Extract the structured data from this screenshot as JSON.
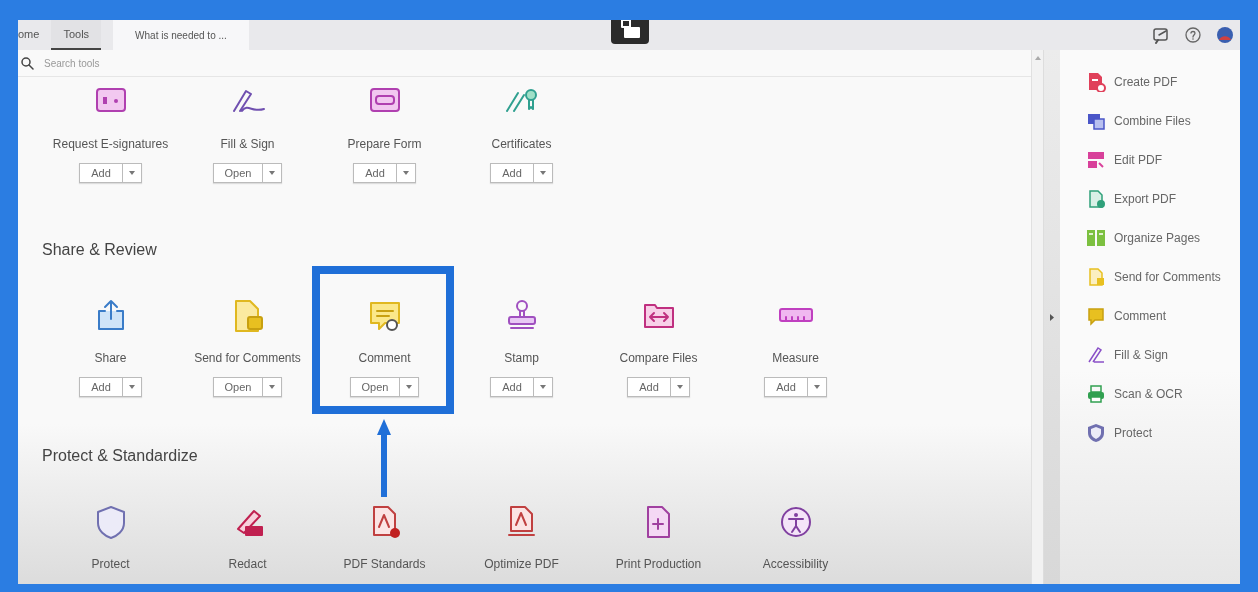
{
  "tabs": [
    {
      "label": "ome",
      "selected": false
    },
    {
      "label": "Tools",
      "selected": true
    }
  ],
  "document_tab": {
    "title": "What is needed to ..."
  },
  "search": {
    "placeholder": "Search tools"
  },
  "sections": [
    {
      "tools": [
        {
          "label": "Request E-signatures",
          "action": "Add",
          "highlighted": false
        },
        {
          "label": "Fill & Sign",
          "action": "Open",
          "highlighted": false
        },
        {
          "label": "Prepare Form",
          "action": "Add",
          "highlighted": false
        },
        {
          "label": "Certificates",
          "action": "Add",
          "highlighted": false
        }
      ]
    },
    {
      "heading": "Share & Review",
      "tools": [
        {
          "label": "Share",
          "action": "Add",
          "highlighted": false
        },
        {
          "label": "Send for Comments",
          "action": "Open",
          "highlighted": false
        },
        {
          "label": "Comment",
          "action": "Open",
          "highlighted": true
        },
        {
          "label": "Stamp",
          "action": "Add",
          "highlighted": false
        },
        {
          "label": "Compare Files",
          "action": "Add",
          "highlighted": false
        },
        {
          "label": "Measure",
          "action": "Add",
          "highlighted": false
        }
      ]
    },
    {
      "heading": "Protect & Standardize",
      "tools": [
        {
          "label": "Protect",
          "highlighted": false
        },
        {
          "label": "Redact",
          "highlighted": false
        },
        {
          "label": "PDF Standards",
          "highlighted": false
        },
        {
          "label": "Optimize PDF",
          "highlighted": false
        },
        {
          "label": "Print Production",
          "highlighted": false
        },
        {
          "label": "Accessibility",
          "highlighted": false
        }
      ]
    }
  ],
  "sidebar": {
    "items": [
      {
        "label": "Create PDF",
        "color": "#e0405a"
      },
      {
        "label": "Combine Files",
        "color": "#4a56c8"
      },
      {
        "label": "Edit PDF",
        "color": "#d8409a"
      },
      {
        "label": "Export PDF",
        "color": "#2fa07a"
      },
      {
        "label": "Organize Pages",
        "color": "#7cc040"
      },
      {
        "label": "Send for Comments",
        "color": "#e8c020"
      },
      {
        "label": "Comment",
        "color": "#e8c020"
      },
      {
        "label": "Fill & Sign",
        "color": "#8a50c8"
      },
      {
        "label": "Scan & OCR",
        "color": "#30a050"
      },
      {
        "label": "Protect",
        "color": "#7070b0"
      }
    ]
  }
}
